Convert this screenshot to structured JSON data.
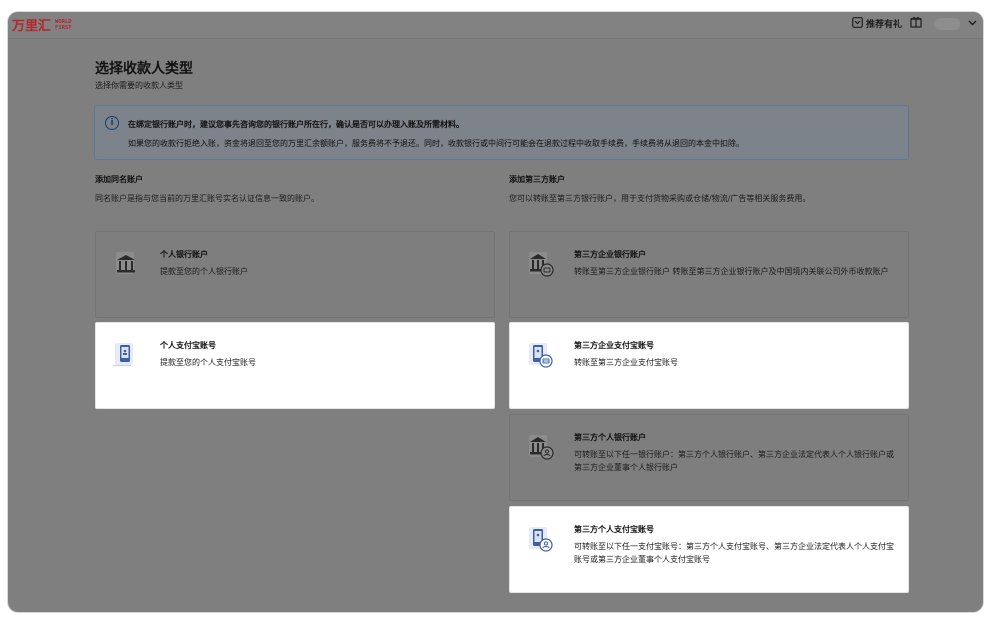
{
  "topbar": {
    "logo_cn": "万里汇",
    "logo_en_1": "WORLD",
    "logo_en_2": "FIRST",
    "refer_label": "推荐有礼"
  },
  "page": {
    "title": "选择收款人类型",
    "subtitle": "选择你需要的收款人类型"
  },
  "notice": {
    "line1": "在绑定银行账户时，建议您事先咨询您的银行账户所在行，确认是否可以办理入账及所需材料。",
    "line2": "如果您的收款行拒绝入账，资金将退回至您的万里汇余额账户，服务费将不予退还。同时，收款银行或中间行可能会在退款过程中收取手续费，手续费将从退回的本金中扣除。"
  },
  "sections": {
    "same_name": {
      "title": "添加同名账户",
      "desc": "同名账户是指与您当前的万里汇账号实名认证信息一致的账户。"
    },
    "third_party": {
      "title": "添加第三方账户",
      "desc": "您可以转账至第三方银行账户，用于支付货物采购或仓储/物流/广告等相关服务费用。"
    }
  },
  "cards": {
    "personal_bank": {
      "title": "个人银行账户",
      "desc": "提款至您的个人银行账户"
    },
    "personal_alipay": {
      "title": "个人支付宝账号",
      "desc": "提款至您的个人支付宝账号"
    },
    "tp_corp_bank": {
      "title": "第三方企业银行账户",
      "desc": "转账至第三方企业银行账户 转账至第三方企业银行账户及中国境内关联公司外币收款账户"
    },
    "tp_corp_alipay": {
      "title": "第三方企业支付宝账号",
      "desc": "转账至第三方企业支付宝账号"
    },
    "tp_personal_bank": {
      "title": "第三方个人银行账户",
      "desc": "可转账至以下任一银行账户：第三方个人银行账户、第三方企业法定代表人个人银行账户或第三方企业董事个人银行账户"
    },
    "tp_personal_alipay": {
      "title": "第三方个人支付宝账号",
      "desc": "可转账至以下任一支付宝账号：第三方个人支付宝账号、第三方企业法定代表人个人支付宝账号或第三方企业董事个人支付宝账号"
    }
  },
  "colors": {
    "brand_red": "#b3262d",
    "notice_border": "#5f7898",
    "notice_icon": "#163e70",
    "icon_blue": "#3c5fa8"
  }
}
